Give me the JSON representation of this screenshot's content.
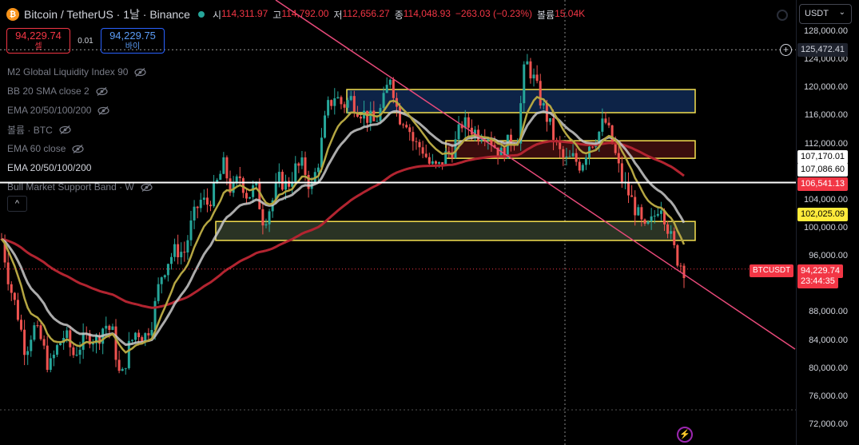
{
  "header": {
    "coin_logo_text": "₿",
    "symbol_title": "Bitcoin / TetherUS · 1날 · Binance",
    "ohlc": {
      "open_label": "시",
      "open": "114,311.97",
      "high_label": "고",
      "high": "114,792.00",
      "low_label": "저",
      "low": "112,656.27",
      "close_label": "종",
      "close": "114,048.93",
      "change": "−263.03 (−0.23%)",
      "volume_label": "볼륨",
      "volume": "15.04K"
    }
  },
  "trade": {
    "sell_price": "94,229.74",
    "sell_label": "셀",
    "spread": "0.01",
    "buy_price": "94,229.75",
    "buy_label": "바이"
  },
  "indicators": [
    {
      "label": "M2 Global Liquidity Index 90"
    },
    {
      "label": "BB 20 SMA close 2"
    },
    {
      "label": "EMA 20/50/100/200"
    },
    {
      "label": "볼륨 · BTC"
    },
    {
      "label": "EMA 60 close"
    },
    {
      "label": "EMA 20/50/100/200"
    },
    {
      "label": "Bull Market Support Band · W"
    }
  ],
  "collapse_button": "^",
  "currency": "USDT",
  "axis_ticks": [
    {
      "label": "128,000.00",
      "price": 128000
    },
    {
      "label": "124,000.00",
      "price": 124000
    },
    {
      "label": "120,000.00",
      "price": 120000
    },
    {
      "label": "116,000.00",
      "price": 116000
    },
    {
      "label": "112,000.00",
      "price": 112000
    },
    {
      "label": "104,000.00",
      "price": 104000
    },
    {
      "label": "100,000.00",
      "price": 100000
    },
    {
      "label": "96,000.00",
      "price": 96000
    },
    {
      "label": "88,000.00",
      "price": 88000
    },
    {
      "label": "84,000.00",
      "price": 84000
    },
    {
      "label": "80,000.00",
      "price": 80000
    },
    {
      "label": "76,000.00",
      "price": 76000
    },
    {
      "label": "72,000.00",
      "price": 72000
    }
  ],
  "price_tags": [
    {
      "label": "125,472.41",
      "price": 125472.41,
      "bg": "#1e222d",
      "fg": "#d1d4dc"
    },
    {
      "label": "107,170.01",
      "price": 107170.01,
      "bg": "#ffffff",
      "fg": "#000000"
    },
    {
      "label": "107,086.60",
      "price": 107086.6,
      "bg": "#ffffff",
      "fg": "#000000"
    },
    {
      "label": "106,541.13",
      "price": 106541.13,
      "bg": "#f23645",
      "fg": "#ffffff"
    },
    {
      "label": "102,025.09",
      "price": 102025.09,
      "bg": "#ffeb3b",
      "fg": "#000000"
    },
    {
      "label": "94,229.74",
      "price": 94229.74,
      "bg": "#f23645",
      "fg": "#ffffff"
    }
  ],
  "countdown": "23:44:35",
  "symbol_label": "BTCUSDT",
  "flash_icon": "⚡",
  "colors": {
    "up": "#26a69a",
    "down": "#ef5350",
    "ema_yellow": "#b5a642",
    "ema_gray": "#c9c9c9",
    "ema_red": "#b22430",
    "trendline": "#e84a7a",
    "zone_border": "#f5e050"
  },
  "chart_data": {
    "type": "candlestick",
    "y_range": [
      70000,
      130000
    ],
    "zones": [
      {
        "top": 119800,
        "bottom": 116500,
        "fill": "#0d2347"
      },
      {
        "top": 112500,
        "bottom": 110000,
        "fill": "#3a0d0d"
      },
      {
        "top": 101000,
        "bottom": 98300,
        "fill": "#2a3324"
      }
    ],
    "horizontal_lines": [
      {
        "price": 106541.13,
        "color": "#ffffff"
      },
      {
        "price": 125472.41,
        "color": "#9a9a9a",
        "dashed": true
      },
      {
        "price": 94229.74,
        "color": "#f23645",
        "dotted": true
      }
    ],
    "candle_anchors": [
      [
        98500,
        92000,
        88000,
        82500,
        86000,
        84000,
        80000,
        83000,
        85000,
        82000,
        83500,
        84800,
        84000,
        86500,
        85000,
        78000,
        83000,
        85500,
        84500,
        87000,
        93000,
        95500,
        97000,
        96500,
        101000,
        104000,
        103500,
        106000,
        109000,
        105000,
        107500,
        104500,
        106000,
        101000,
        103500,
        107000,
        106000,
        108500,
        109000,
        105500,
        110000,
        117000,
        119000,
        117500,
        118500,
        117000,
        116000,
        115000,
        117500,
        122000,
        116000,
        115500,
        112000,
        111500,
        109000,
        108500,
        110500,
        111500,
        115000,
        114500,
        113500,
        114000,
        112000,
        110500,
        112500,
        113000,
        124000,
        121500,
        118000,
        115000,
        111500,
        109500,
        110000,
        109000,
        112000,
        113000,
        115500,
        112000,
        107500,
        105000,
        102500,
        99500,
        101000,
        104000,
        100000,
        96000,
        94230
      ]
    ]
  }
}
